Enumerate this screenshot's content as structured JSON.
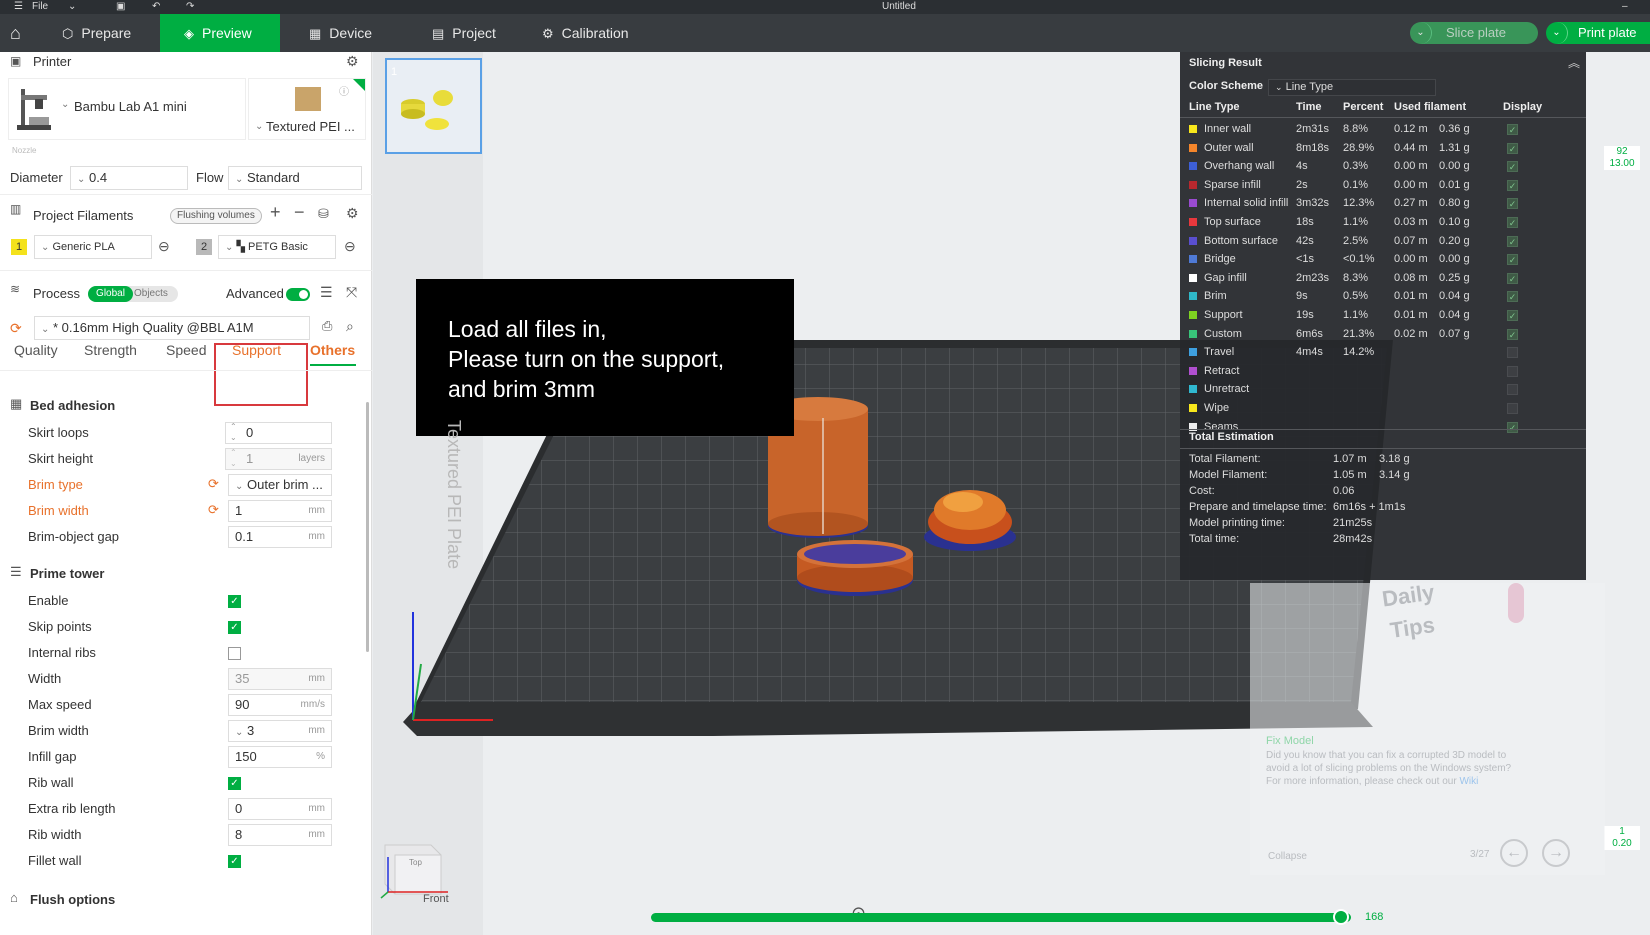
{
  "titlebar": {
    "file_menu": "File",
    "window_title": "Untitled"
  },
  "toolbar": {
    "tabs": [
      {
        "label": "Prepare",
        "icon": "cube-outline-icon"
      },
      {
        "label": "Preview",
        "icon": "layers-icon"
      },
      {
        "label": "Device",
        "icon": "device-icon"
      },
      {
        "label": "Project",
        "icon": "project-icon"
      },
      {
        "label": "Calibration",
        "icon": "calibration-icon"
      }
    ],
    "active_tab": "Preview",
    "slice_button": "Slice plate",
    "print_button": "Print plate"
  },
  "printer": {
    "section_title": "Printer",
    "printer_name": "Bambu Lab A1 mini",
    "plate": "Textured PEI ...",
    "nozzle_label": "Nozzle",
    "diameter_label": "Diameter",
    "diameter_value": "0.4",
    "flow_label": "Flow",
    "flow_value": "Standard"
  },
  "filaments": {
    "section_title": "Project Filaments",
    "flushing_button": "Flushing volumes",
    "items": [
      {
        "index": "1",
        "name": "Generic PLA",
        "color": "#f4e21c"
      },
      {
        "index": "2",
        "name": "PETG Basic",
        "color": "#b9b9b9"
      }
    ]
  },
  "process": {
    "section_title": "Process",
    "toggle_global": "Global",
    "toggle_objects": "Objects",
    "advanced_label": "Advanced",
    "profile": "* 0.16mm High Quality @BBL A1M",
    "tabs": [
      "Quality",
      "Strength",
      "Speed",
      "Support",
      "Others"
    ],
    "active_tab": "Others",
    "highlighted_tab": "Support"
  },
  "bed_adhesion": {
    "title": "Bed adhesion",
    "skirt_loops_label": "Skirt loops",
    "skirt_loops": "0",
    "skirt_height_label": "Skirt height",
    "skirt_height": "1",
    "skirt_height_unit": "layers",
    "brim_type_label": "Brim type",
    "brim_type": "Outer brim ...",
    "brim_width_label": "Brim width",
    "brim_width": "1",
    "brim_width_unit": "mm",
    "brim_gap_label": "Brim-object gap",
    "brim_gap": "0.1",
    "brim_gap_unit": "mm"
  },
  "prime_tower": {
    "title": "Prime tower",
    "enable_label": "Enable",
    "skip_points_label": "Skip points",
    "internal_ribs_label": "Internal ribs",
    "width_label": "Width",
    "width": "35",
    "width_unit": "mm",
    "max_speed_label": "Max speed",
    "max_speed": "90",
    "max_speed_unit": "mm/s",
    "brim_width_label": "Brim width",
    "brim_width": "3",
    "brim_width_unit": "mm",
    "infill_gap_label": "Infill gap",
    "infill_gap": "150",
    "infill_gap_unit": "%",
    "rib_wall_label": "Rib wall",
    "extra_rib_label": "Extra rib length",
    "extra_rib": "0",
    "extra_rib_unit": "mm",
    "rib_width_label": "Rib width",
    "rib_width": "8",
    "rib_width_unit": "mm",
    "fillet_label": "Fillet wall"
  },
  "flush_options": {
    "title": "Flush options"
  },
  "plate_thumb": {
    "index": "1"
  },
  "annotation": {
    "line1": "Load all files in,",
    "line2": "Please turn on the support,",
    "line3": "and brim 3mm"
  },
  "bed_text": "Textured PEI Plate",
  "view_cube": {
    "top": "Top",
    "front": "Front"
  },
  "slicing": {
    "title": "Slicing Result",
    "color_scheme_label": "Color Scheme",
    "color_scheme_value": "Line Type",
    "headers": [
      "Line Type",
      "Time",
      "Percent",
      "Used filament",
      "Display"
    ],
    "rows": [
      {
        "name": "Inner wall",
        "color": "#f8e71c",
        "time": "2m31s",
        "percent": "8.8%",
        "len": "0.12 m",
        "weight": "0.36 g",
        "display": true
      },
      {
        "name": "Outer wall",
        "color": "#f5862b",
        "time": "8m18s",
        "percent": "28.9%",
        "len": "0.44 m",
        "weight": "1.31 g",
        "display": true
      },
      {
        "name": "Overhang wall",
        "color": "#3d5fd6",
        "time": "4s",
        "percent": "0.3%",
        "len": "0.00 m",
        "weight": "0.00 g",
        "display": true
      },
      {
        "name": "Sparse infill",
        "color": "#b8282e",
        "time": "2s",
        "percent": "0.1%",
        "len": "0.00 m",
        "weight": "0.01 g",
        "display": true
      },
      {
        "name": "Internal solid infill",
        "color": "#9a4bd1",
        "time": "3m32s",
        "percent": "12.3%",
        "len": "0.27 m",
        "weight": "0.80 g",
        "display": true
      },
      {
        "name": "Top surface",
        "color": "#e8383d",
        "time": "18s",
        "percent": "1.1%",
        "len": "0.03 m",
        "weight": "0.10 g",
        "display": true
      },
      {
        "name": "Bottom surface",
        "color": "#5a4fd0",
        "time": "42s",
        "percent": "2.5%",
        "len": "0.07 m",
        "weight": "0.20 g",
        "display": true
      },
      {
        "name": "Bridge",
        "color": "#4f7ad6",
        "time": "<1s",
        "percent": "<0.1%",
        "len": "0.00 m",
        "weight": "0.00 g",
        "display": true
      },
      {
        "name": "Gap infill",
        "color": "#ffffff",
        "time": "2m23s",
        "percent": "8.3%",
        "len": "0.08 m",
        "weight": "0.25 g",
        "display": true
      },
      {
        "name": "Brim",
        "color": "#2fb8c8",
        "time": "9s",
        "percent": "0.5%",
        "len": "0.01 m",
        "weight": "0.04 g",
        "display": true
      },
      {
        "name": "Support",
        "color": "#7ed321",
        "time": "19s",
        "percent": "1.1%",
        "len": "0.01 m",
        "weight": "0.04 g",
        "display": true
      },
      {
        "name": "Custom",
        "color": "#38c47a",
        "time": "6m6s",
        "percent": "21.3%",
        "len": "0.02 m",
        "weight": "0.07 g",
        "display": true
      },
      {
        "name": "Travel",
        "color": "#3ea0e0",
        "time": "4m4s",
        "percent": "14.2%",
        "len": "",
        "weight": "",
        "display": false
      },
      {
        "name": "Retract",
        "color": "#b04fd0",
        "time": "",
        "percent": "",
        "len": "",
        "weight": "",
        "display": false
      },
      {
        "name": "Unretract",
        "color": "#30b8d0",
        "time": "",
        "percent": "",
        "len": "",
        "weight": "",
        "display": false
      },
      {
        "name": "Wipe",
        "color": "#f8e71c",
        "time": "",
        "percent": "",
        "len": "",
        "weight": "",
        "display": false
      },
      {
        "name": "Seams",
        "color": "#eeeeee",
        "time": "",
        "percent": "",
        "len": "",
        "weight": "",
        "display": true
      }
    ],
    "total_title": "Total Estimation",
    "totals": [
      {
        "label": "Total Filament:",
        "v1": "1.07 m",
        "v2": "3.18 g"
      },
      {
        "label": "Model Filament:",
        "v1": "1.05 m",
        "v2": "3.14 g"
      },
      {
        "label": "Cost:",
        "v1": "0.06",
        "v2": ""
      },
      {
        "label": "Prepare and timelapse time:",
        "v1": "6m16s + 1m1s",
        "v2": ""
      },
      {
        "label": "Model printing time:",
        "v1": "21m25s",
        "v2": ""
      },
      {
        "label": "Total time:",
        "v1": "28m42s",
        "v2": ""
      }
    ]
  },
  "layer_slider": {
    "top_layer": "92",
    "top_height": "13.00",
    "bottom_layer": "1",
    "bottom_height": "0.20"
  },
  "move_slider": {
    "value": "168",
    "fraction": 0.985
  },
  "tips": {
    "title_line1": "Daily",
    "title_line2": "Tips",
    "tip_title": "Fix Model",
    "tip_text1": "Did you know that you can fix a corrupted 3D model to",
    "tip_text2": "avoid a lot of slicing problems on the Windows system?",
    "tip_text3": "For more information, please check out our",
    "tip_link": "Wiki",
    "collapse": "Collapse",
    "page": "3/27"
  },
  "colors": {
    "accent": "#00ae42",
    "modified": "#e8712b"
  }
}
